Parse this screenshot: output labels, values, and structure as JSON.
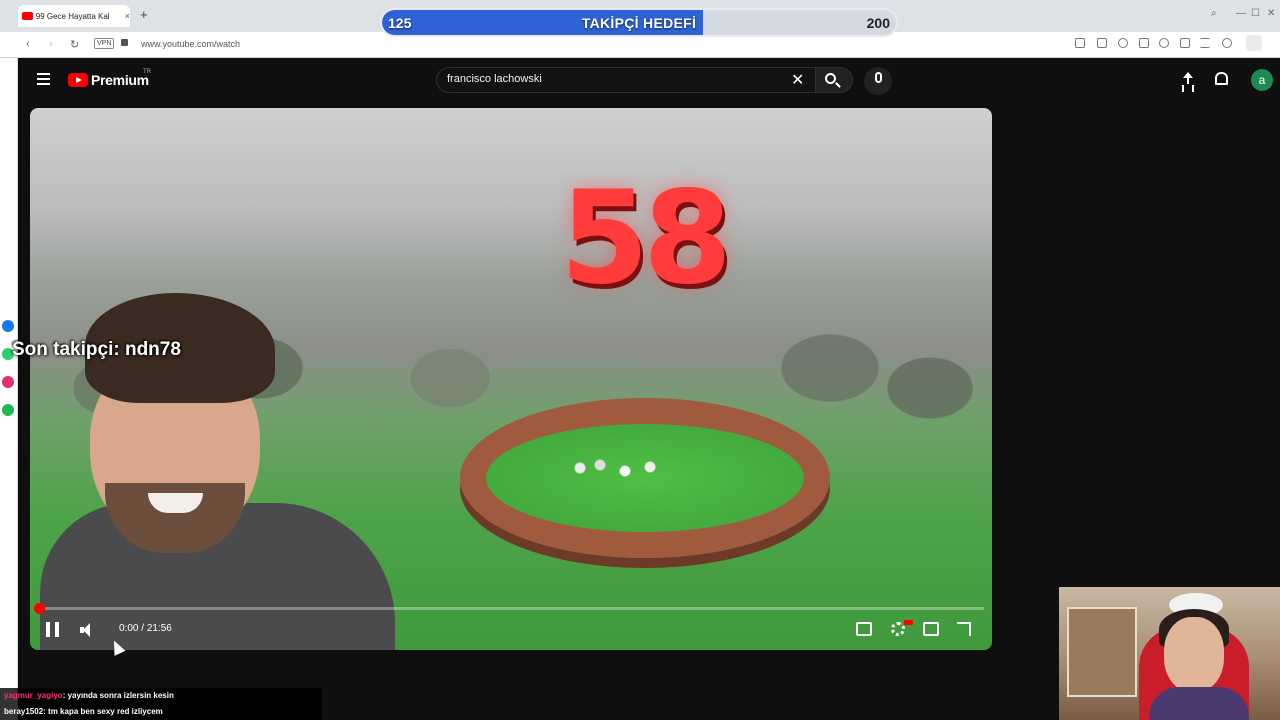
{
  "browser": {
    "tab_title": "99 Gece Hayatta Kal",
    "tab_close": "×",
    "new_tab": "+",
    "url": "www.youtube.com/watch",
    "vpn_label": "VPN",
    "nav": {
      "back": "‹",
      "forward": "›",
      "reload": "↻"
    },
    "window_controls": {
      "search": "⌕",
      "minimize": "—",
      "maximize": "☐",
      "close": "✕"
    }
  },
  "goal_overlay": {
    "current": "125",
    "target": "200",
    "title": "TAKİPÇİ HEDEFİ",
    "progress": 0.625,
    "fill_color": "#2f62d6"
  },
  "youtube": {
    "brand": "Premium",
    "region": "TR",
    "search_query": "francisco lachowski",
    "avatar_letter": "a",
    "avatar_color": "#1e8a53",
    "icons": [
      "menu-icon",
      "youtube-logo-icon",
      "clear-icon",
      "search-icon",
      "mic-icon",
      "upload-icon",
      "bell-icon"
    ]
  },
  "video": {
    "countdown_number": "58",
    "last_follower_text": "Son takipçi: ndn78",
    "time_current": "0:00",
    "time_separator": " / ",
    "time_total": "21:56",
    "progress": 0.0,
    "accent_color": "#ff0000"
  },
  "chat": [
    {
      "user": "yagmur_yagiyo",
      "message": ": yayında sonra izlersin kesin"
    },
    {
      "user": "beray1502",
      "message": ": tm kapa ben sexy red izliycem"
    }
  ]
}
